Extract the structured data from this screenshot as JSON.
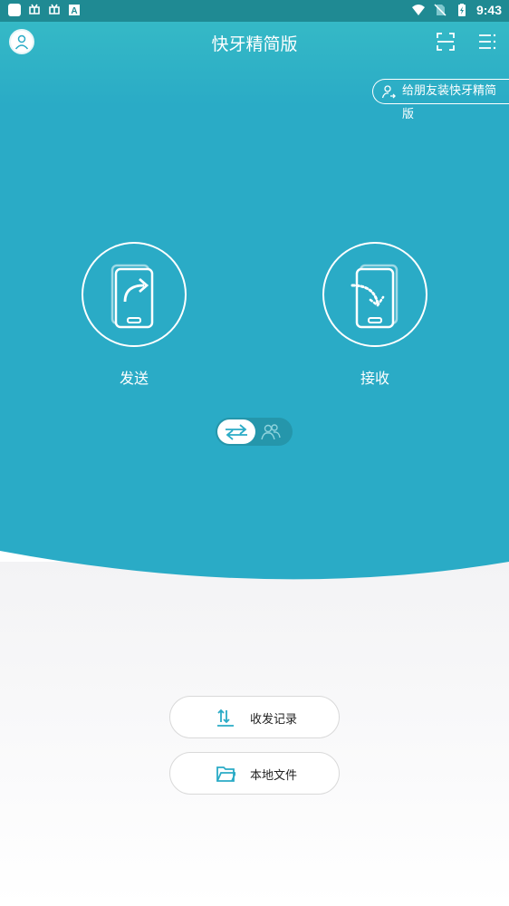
{
  "status_bar": {
    "time": "9:43",
    "left_icons": [
      "app-square-icon",
      "bug-icon",
      "bug-icon",
      "a-badge-icon"
    ],
    "right_icons": [
      "wifi-icon",
      "no-sim-icon",
      "battery-charging-icon"
    ]
  },
  "header": {
    "title": "快牙精简版",
    "icons": [
      "avatar-icon",
      "scan-icon",
      "menu-icon"
    ]
  },
  "invite_button": {
    "label": "给朋友装快牙精简版",
    "icon": "person-share-icon"
  },
  "actions": {
    "send_label": "发送",
    "receive_label": "接收"
  },
  "mode_toggle": {
    "selected": "transfer",
    "icons": [
      "swap-arrows-icon",
      "group-icon"
    ]
  },
  "buttons": {
    "history_label": "收发记录",
    "local_files_label": "本地文件"
  },
  "colors": {
    "accent": "#2aabc6",
    "status_bar": "#1f8a93",
    "background_bottom": "#f5f5f7"
  }
}
